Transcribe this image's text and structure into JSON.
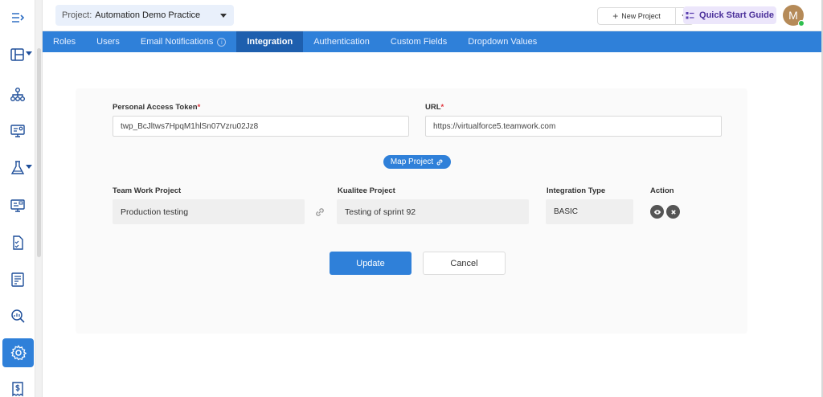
{
  "topbar": {
    "project_label": "Project:",
    "project_name": "Automation Demo Practice",
    "new_project_label": "New Project",
    "quick_start_label": "Quick Start Guide",
    "avatar_initial": "M"
  },
  "tabs": [
    {
      "label": "Roles"
    },
    {
      "label": "Users"
    },
    {
      "label": "Email Notifications"
    },
    {
      "label": "Integration"
    },
    {
      "label": "Authentication"
    },
    {
      "label": "Custom Fields"
    },
    {
      "label": "Dropdown Values"
    }
  ],
  "form": {
    "token_label": "Personal Access Token",
    "token_value": "twp_BcJltws7HpqM1hlSn07Vzru02Jz8",
    "url_label": "URL",
    "url_value": "https://virtualforce5.teamwork.com",
    "required_mark": "*",
    "map_project_label": "Map Project"
  },
  "mapping": {
    "col_teamwork": "Team Work Project",
    "col_kualitee": "Kualitee Project",
    "col_type": "Integration Type",
    "col_action": "Action",
    "teamwork_project": "Production testing",
    "kualitee_project": "Testing of sprint 92",
    "integration_type": "BASIC"
  },
  "actions": {
    "update_label": "Update",
    "cancel_label": "Cancel"
  },
  "colors": {
    "accent": "#2f80d9",
    "tab_active": "#1e5fae",
    "required": "#e0333b"
  }
}
